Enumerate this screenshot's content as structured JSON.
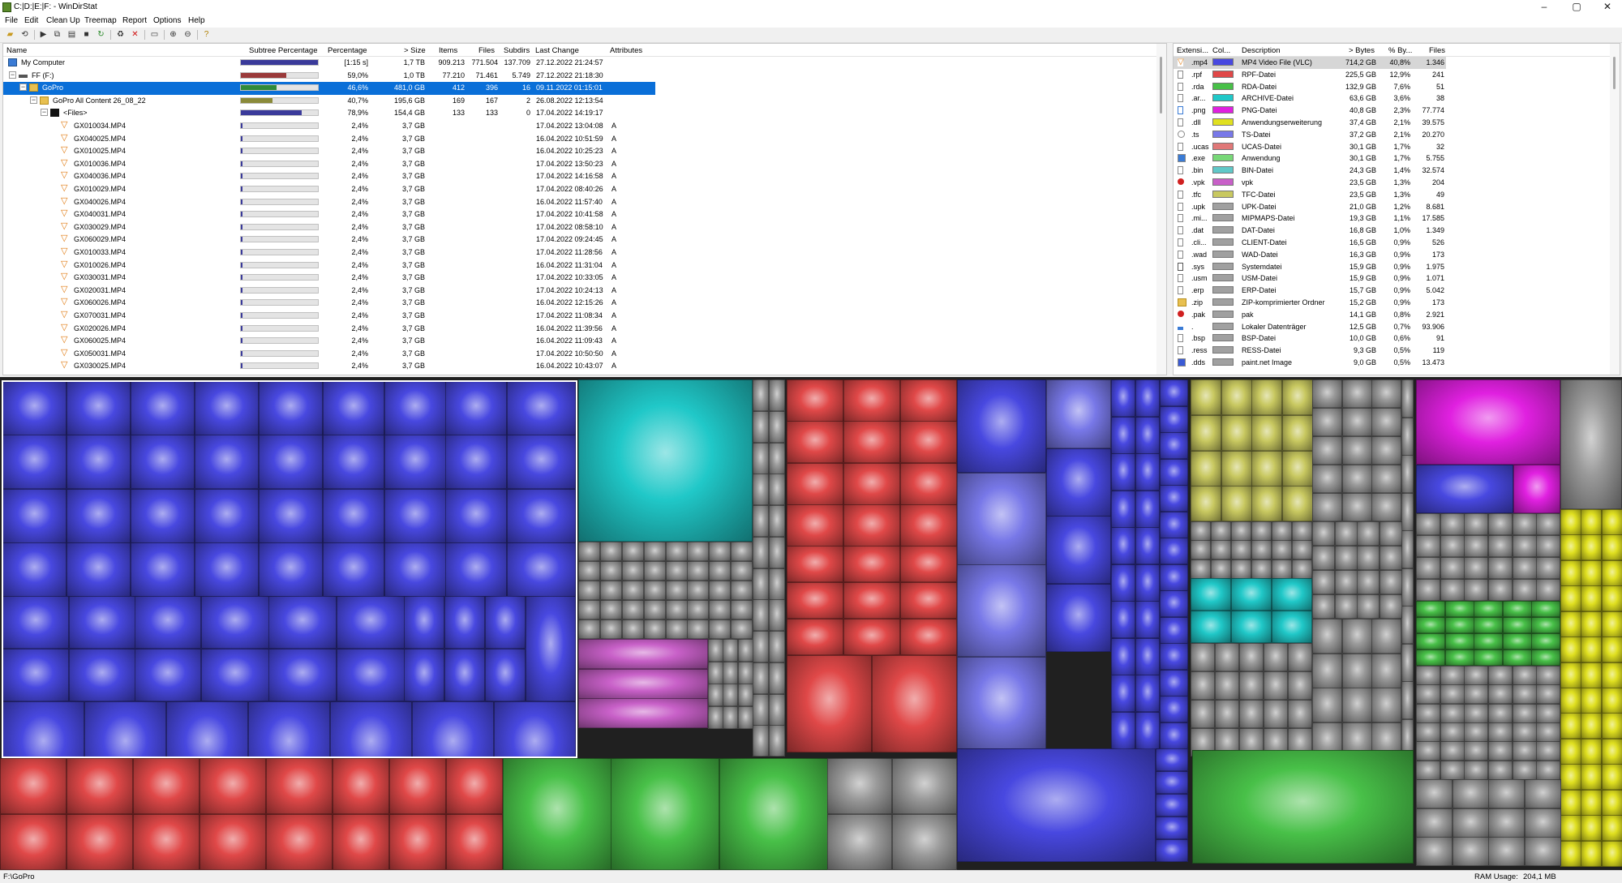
{
  "window": {
    "title": "C:|D:|E:|F: - WinDirStat"
  },
  "window_buttons": [
    "–",
    "▢",
    "✕"
  ],
  "menu": [
    "File",
    "Edit",
    "Clean Up",
    "Treemap",
    "Report",
    "Options",
    "Help"
  ],
  "toolbar_icons": [
    "open-icon",
    "refresh-all-icon",
    "play-icon",
    "copy-path-icon",
    "explorer-icon",
    "command-prompt-icon",
    "refresh-selected-icon",
    "clean-up-icon",
    "delete-icon",
    "new-folder-icon",
    "zoom-in-icon",
    "zoom-out-icon",
    "help-icon"
  ],
  "tree": {
    "headers": [
      "Name",
      "Subtree Percentage",
      "Percentage",
      "> Size",
      "Items",
      "Files",
      "Subdirs",
      "Last Change",
      "Attributes"
    ],
    "rows": [
      {
        "name": "My Computer",
        "depth": 0,
        "icon": "computer",
        "subtree": 1.0,
        "barcolor": "#3a3a9a",
        "pct": "[1:15 s]",
        "size": "1,7 TB",
        "items": "909.213",
        "files": "771.504",
        "subdirs": "137.709",
        "last": "27.12.2022 21:24:57",
        "attr": ""
      },
      {
        "name": "FF (F:)",
        "depth": 1,
        "icon": "drive",
        "subtree": 0.59,
        "barcolor": "#9a3a3a",
        "pct": "59,0%",
        "size": "1,0 TB",
        "items": "77.210",
        "files": "71.461",
        "subdirs": "5.749",
        "last": "27.12.2022 21:18:30",
        "attr": ""
      },
      {
        "name": "GoPro",
        "depth": 2,
        "icon": "folder",
        "subtree": 0.466,
        "barcolor": "#2f8a3a",
        "pct": "46,6%",
        "size": "481,0 GB",
        "items": "412",
        "files": "396",
        "subdirs": "16",
        "last": "09.11.2022 01:15:01",
        "attr": "",
        "selected": true
      },
      {
        "name": "GoPro All Content 26_08_22",
        "depth": 3,
        "icon": "folder",
        "subtree": 0.407,
        "barcolor": "#8a8a3a",
        "pct": "40,7%",
        "size": "195,6 GB",
        "items": "169",
        "files": "167",
        "subdirs": "2",
        "last": "26.08.2022 12:13:54",
        "attr": ""
      },
      {
        "name": "<Files>",
        "depth": 4,
        "icon": "files",
        "subtree": 0.789,
        "barcolor": "#3a3a9a",
        "pct": "78,9%",
        "size": "154,4 GB",
        "items": "133",
        "files": "133",
        "subdirs": "0",
        "last": "17.04.2022 14:19:17",
        "attr": ""
      },
      {
        "name": "GX010034.MP4",
        "depth": 5,
        "icon": "vlc",
        "subtree": 0.024,
        "barcolor": "#3a3a9a",
        "pct": "2,4%",
        "size": "3,7 GB",
        "items": "",
        "files": "",
        "subdirs": "",
        "last": "17.04.2022 13:04:08",
        "attr": "A"
      },
      {
        "name": "GX040025.MP4",
        "depth": 5,
        "icon": "vlc",
        "subtree": 0.024,
        "barcolor": "#3a3a9a",
        "pct": "2,4%",
        "size": "3,7 GB",
        "items": "",
        "files": "",
        "subdirs": "",
        "last": "16.04.2022 10:51:59",
        "attr": "A"
      },
      {
        "name": "GX010025.MP4",
        "depth": 5,
        "icon": "vlc",
        "subtree": 0.024,
        "barcolor": "#3a3a9a",
        "pct": "2,4%",
        "size": "3,7 GB",
        "items": "",
        "files": "",
        "subdirs": "",
        "last": "16.04.2022 10:25:23",
        "attr": "A"
      },
      {
        "name": "GX010036.MP4",
        "depth": 5,
        "icon": "vlc",
        "subtree": 0.024,
        "barcolor": "#3a3a9a",
        "pct": "2,4%",
        "size": "3,7 GB",
        "items": "",
        "files": "",
        "subdirs": "",
        "last": "17.04.2022 13:50:23",
        "attr": "A"
      },
      {
        "name": "GX040036.MP4",
        "depth": 5,
        "icon": "vlc",
        "subtree": 0.024,
        "barcolor": "#3a3a9a",
        "pct": "2,4%",
        "size": "3,7 GB",
        "items": "",
        "files": "",
        "subdirs": "",
        "last": "17.04.2022 14:16:58",
        "attr": "A"
      },
      {
        "name": "GX010029.MP4",
        "depth": 5,
        "icon": "vlc",
        "subtree": 0.024,
        "barcolor": "#3a3a9a",
        "pct": "2,4%",
        "size": "3,7 GB",
        "items": "",
        "files": "",
        "subdirs": "",
        "last": "17.04.2022 08:40:26",
        "attr": "A"
      },
      {
        "name": "GX040026.MP4",
        "depth": 5,
        "icon": "vlc",
        "subtree": 0.024,
        "barcolor": "#3a3a9a",
        "pct": "2,4%",
        "size": "3,7 GB",
        "items": "",
        "files": "",
        "subdirs": "",
        "last": "16.04.2022 11:57:40",
        "attr": "A"
      },
      {
        "name": "GX040031.MP4",
        "depth": 5,
        "icon": "vlc",
        "subtree": 0.024,
        "barcolor": "#3a3a9a",
        "pct": "2,4%",
        "size": "3,7 GB",
        "items": "",
        "files": "",
        "subdirs": "",
        "last": "17.04.2022 10:41:58",
        "attr": "A"
      },
      {
        "name": "GX030029.MP4",
        "depth": 5,
        "icon": "vlc",
        "subtree": 0.024,
        "barcolor": "#3a3a9a",
        "pct": "2,4%",
        "size": "3,7 GB",
        "items": "",
        "files": "",
        "subdirs": "",
        "last": "17.04.2022 08:58:10",
        "attr": "A"
      },
      {
        "name": "GX060029.MP4",
        "depth": 5,
        "icon": "vlc",
        "subtree": 0.024,
        "barcolor": "#3a3a9a",
        "pct": "2,4%",
        "size": "3,7 GB",
        "items": "",
        "files": "",
        "subdirs": "",
        "last": "17.04.2022 09:24:45",
        "attr": "A"
      },
      {
        "name": "GX010033.MP4",
        "depth": 5,
        "icon": "vlc",
        "subtree": 0.024,
        "barcolor": "#3a3a9a",
        "pct": "2,4%",
        "size": "3,7 GB",
        "items": "",
        "files": "",
        "subdirs": "",
        "last": "17.04.2022 11:28:56",
        "attr": "A"
      },
      {
        "name": "GX010026.MP4",
        "depth": 5,
        "icon": "vlc",
        "subtree": 0.024,
        "barcolor": "#3a3a9a",
        "pct": "2,4%",
        "size": "3,7 GB",
        "items": "",
        "files": "",
        "subdirs": "",
        "last": "16.04.2022 11:31:04",
        "attr": "A"
      },
      {
        "name": "GX030031.MP4",
        "depth": 5,
        "icon": "vlc",
        "subtree": 0.024,
        "barcolor": "#3a3a9a",
        "pct": "2,4%",
        "size": "3,7 GB",
        "items": "",
        "files": "",
        "subdirs": "",
        "last": "17.04.2022 10:33:05",
        "attr": "A"
      },
      {
        "name": "GX020031.MP4",
        "depth": 5,
        "icon": "vlc",
        "subtree": 0.024,
        "barcolor": "#3a3a9a",
        "pct": "2,4%",
        "size": "3,7 GB",
        "items": "",
        "files": "",
        "subdirs": "",
        "last": "17.04.2022 10:24:13",
        "attr": "A"
      },
      {
        "name": "GX060026.MP4",
        "depth": 5,
        "icon": "vlc",
        "subtree": 0.024,
        "barcolor": "#3a3a9a",
        "pct": "2,4%",
        "size": "3,7 GB",
        "items": "",
        "files": "",
        "subdirs": "",
        "last": "16.04.2022 12:15:26",
        "attr": "A"
      },
      {
        "name": "GX070031.MP4",
        "depth": 5,
        "icon": "vlc",
        "subtree": 0.024,
        "barcolor": "#3a3a9a",
        "pct": "2,4%",
        "size": "3,7 GB",
        "items": "",
        "files": "",
        "subdirs": "",
        "last": "17.04.2022 11:08:34",
        "attr": "A"
      },
      {
        "name": "GX020026.MP4",
        "depth": 5,
        "icon": "vlc",
        "subtree": 0.024,
        "barcolor": "#3a3a9a",
        "pct": "2,4%",
        "size": "3,7 GB",
        "items": "",
        "files": "",
        "subdirs": "",
        "last": "16.04.2022 11:39:56",
        "attr": "A"
      },
      {
        "name": "GX060025.MP4",
        "depth": 5,
        "icon": "vlc",
        "subtree": 0.024,
        "barcolor": "#3a3a9a",
        "pct": "2,4%",
        "size": "3,7 GB",
        "items": "",
        "files": "",
        "subdirs": "",
        "last": "16.04.2022 11:09:43",
        "attr": "A"
      },
      {
        "name": "GX050031.MP4",
        "depth": 5,
        "icon": "vlc",
        "subtree": 0.024,
        "barcolor": "#3a3a9a",
        "pct": "2,4%",
        "size": "3,7 GB",
        "items": "",
        "files": "",
        "subdirs": "",
        "last": "17.04.2022 10:50:50",
        "attr": "A"
      },
      {
        "name": "GX030025.MP4",
        "depth": 5,
        "icon": "vlc",
        "subtree": 0.024,
        "barcolor": "#3a3a9a",
        "pct": "2,4%",
        "size": "3,7 GB",
        "items": "",
        "files": "",
        "subdirs": "",
        "last": "16.04.2022 10:43:07",
        "attr": "A"
      }
    ]
  },
  "extensions": {
    "headers": [
      "Extensi...",
      "Col...",
      "Description",
      "> Bytes",
      "% By...",
      "Files"
    ],
    "rows": [
      {
        "ext": ".mp4",
        "color": "#4848e0",
        "desc": "MP4 Video File (VLC)",
        "bytes": "714,2 GB",
        "pct": "40,8%",
        "files": "1.346",
        "icon": "vlc",
        "selected": true
      },
      {
        "ext": ".rpf",
        "color": "#e04848",
        "desc": "RPF-Datei",
        "bytes": "225,5 GB",
        "pct": "12,9%",
        "files": "241",
        "icon": "file"
      },
      {
        "ext": ".rda",
        "color": "#48c048",
        "desc": "RDA-Datei",
        "bytes": "132,9 GB",
        "pct": "7,6%",
        "files": "51",
        "icon": "file"
      },
      {
        "ext": ".ar...",
        "color": "#20c8c8",
        "desc": "ARCHIVE-Datei",
        "bytes": "63,6 GB",
        "pct": "3,6%",
        "files": "38",
        "icon": "file"
      },
      {
        "ext": ".png",
        "color": "#e020e0",
        "desc": "PNG-Datei",
        "bytes": "40,8 GB",
        "pct": "2,3%",
        "files": "77.774",
        "icon": "image"
      },
      {
        "ext": ".dll",
        "color": "#e0e020",
        "desc": "Anwendungserweiterung",
        "bytes": "37,4 GB",
        "pct": "2,1%",
        "files": "39.575",
        "icon": "file"
      },
      {
        "ext": ".ts",
        "color": "#7878e8",
        "desc": "TS-Datei",
        "bytes": "37,2 GB",
        "pct": "2,1%",
        "files": "20.270",
        "icon": "disc"
      },
      {
        "ext": ".ucas",
        "color": "#e07878",
        "desc": "UCAS-Datei",
        "bytes": "30,1 GB",
        "pct": "1,7%",
        "files": "32",
        "icon": "file"
      },
      {
        "ext": ".exe",
        "color": "#78d878",
        "desc": "Anwendung",
        "bytes": "30,1 GB",
        "pct": "1,7%",
        "files": "5.755",
        "icon": "app"
      },
      {
        "ext": ".bin",
        "color": "#60c8c8",
        "desc": "BIN-Datei",
        "bytes": "24,3 GB",
        "pct": "1,4%",
        "files": "32.574",
        "icon": "file"
      },
      {
        "ext": ".vpk",
        "color": "#c860c8",
        "desc": "vpk",
        "bytes": "23,5 GB",
        "pct": "1,3%",
        "files": "204",
        "icon": "game"
      },
      {
        "ext": ".tfc",
        "color": "#c8c860",
        "desc": "TFC-Datei",
        "bytes": "23,5 GB",
        "pct": "1,3%",
        "files": "49",
        "icon": "file"
      },
      {
        "ext": ".upk",
        "color": "#a0a0a0",
        "desc": "UPK-Datei",
        "bytes": "21,0 GB",
        "pct": "1,2%",
        "files": "8.681",
        "icon": "file"
      },
      {
        "ext": ".mi...",
        "color": "#a0a0a0",
        "desc": "MIPMAPS-Datei",
        "bytes": "19,3 GB",
        "pct": "1,1%",
        "files": "17.585",
        "icon": "file"
      },
      {
        "ext": ".dat",
        "color": "#a0a0a0",
        "desc": "DAT-Datei",
        "bytes": "16,8 GB",
        "pct": "1,0%",
        "files": "1.349",
        "icon": "file"
      },
      {
        "ext": ".cli...",
        "color": "#a0a0a0",
        "desc": "CLIENT-Datei",
        "bytes": "16,5 GB",
        "pct": "0,9%",
        "files": "526",
        "icon": "file"
      },
      {
        "ext": ".wad",
        "color": "#a0a0a0",
        "desc": "WAD-Datei",
        "bytes": "16,3 GB",
        "pct": "0,9%",
        "files": "173",
        "icon": "file"
      },
      {
        "ext": ".sys",
        "color": "#a0a0a0",
        "desc": "Systemdatei",
        "bytes": "15,9 GB",
        "pct": "0,9%",
        "files": "1.975",
        "icon": "sys"
      },
      {
        "ext": ".usm",
        "color": "#a0a0a0",
        "desc": "USM-Datei",
        "bytes": "15,9 GB",
        "pct": "0,9%",
        "files": "1.071",
        "icon": "file"
      },
      {
        "ext": ".erp",
        "color": "#a0a0a0",
        "desc": "ERP-Datei",
        "bytes": "15,7 GB",
        "pct": "0,9%",
        "files": "5.042",
        "icon": "file"
      },
      {
        "ext": ".zip",
        "color": "#a0a0a0",
        "desc": "ZIP-komprimierter Ordner",
        "bytes": "15,2 GB",
        "pct": "0,9%",
        "files": "173",
        "icon": "zip"
      },
      {
        "ext": ".pak",
        "color": "#a0a0a0",
        "desc": "pak",
        "bytes": "14,1 GB",
        "pct": "0,8%",
        "files": "2.921",
        "icon": "game"
      },
      {
        "ext": ".",
        "color": "#a0a0a0",
        "desc": "Lokaler Datenträger",
        "bytes": "12,5 GB",
        "pct": "0,7%",
        "files": "93.906",
        "icon": "drive"
      },
      {
        "ext": ".bsp",
        "color": "#a0a0a0",
        "desc": "BSP-Datei",
        "bytes": "10,0 GB",
        "pct": "0,6%",
        "files": "91",
        "icon": "file"
      },
      {
        "ext": ".ress",
        "color": "#a0a0a0",
        "desc": "RESS-Datei",
        "bytes": "9,3 GB",
        "pct": "0,5%",
        "files": "119",
        "icon": "file"
      },
      {
        "ext": ".dds",
        "color": "#a0a0a0",
        "desc": "paint.net Image",
        "bytes": "9,0 GB",
        "pct": "0,5%",
        "files": "13.473",
        "icon": "image2"
      }
    ]
  },
  "status": {
    "path": "F:\\GoPro",
    "ram_label": "RAM Usage:",
    "ram_value": "204,1 MB"
  }
}
